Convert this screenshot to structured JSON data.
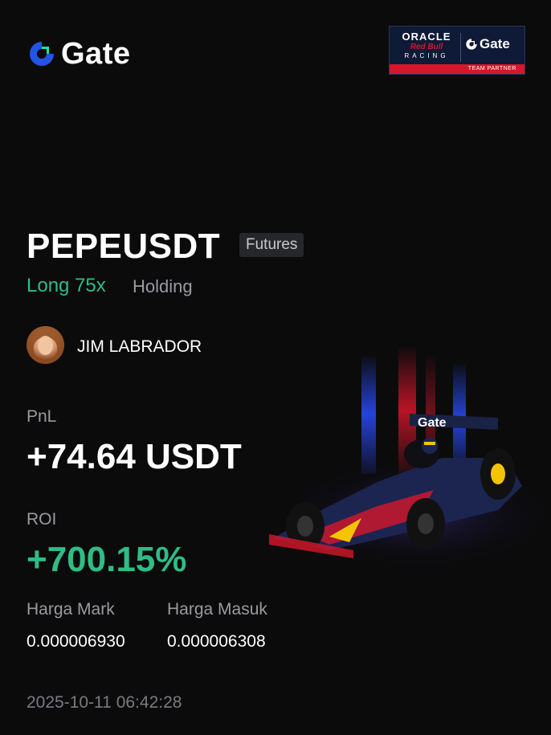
{
  "brand": {
    "name": "Gate",
    "icon": "gate-logo-icon"
  },
  "partner": {
    "oracle": "ORACLE",
    "redbull": "Red Bull",
    "racing": "RACING",
    "gate": "Gate",
    "footer": "TEAM PARTNER"
  },
  "position": {
    "pair": "PEPEUSDT",
    "type_tag": "Futures",
    "side": "Long 75x",
    "status": "Holding"
  },
  "user": {
    "name": "JIM LABRADOR"
  },
  "pnl": {
    "label": "PnL",
    "value": "+74.64 USDT"
  },
  "roi": {
    "label": "ROI",
    "value": "+700.15%"
  },
  "prices": {
    "mark_label": "Harga Mark",
    "mark_value": "0.000006930",
    "entry_label": "Harga Masuk",
    "entry_value": "0.000006308"
  },
  "timestamp": "2025-10-11 06:42:28",
  "colors": {
    "background": "#0b0b0c",
    "positive": "#2ebd85",
    "brand_blue": "#2354e6",
    "brand_green": "#17e6a1",
    "redbull_red": "#d6162a"
  }
}
